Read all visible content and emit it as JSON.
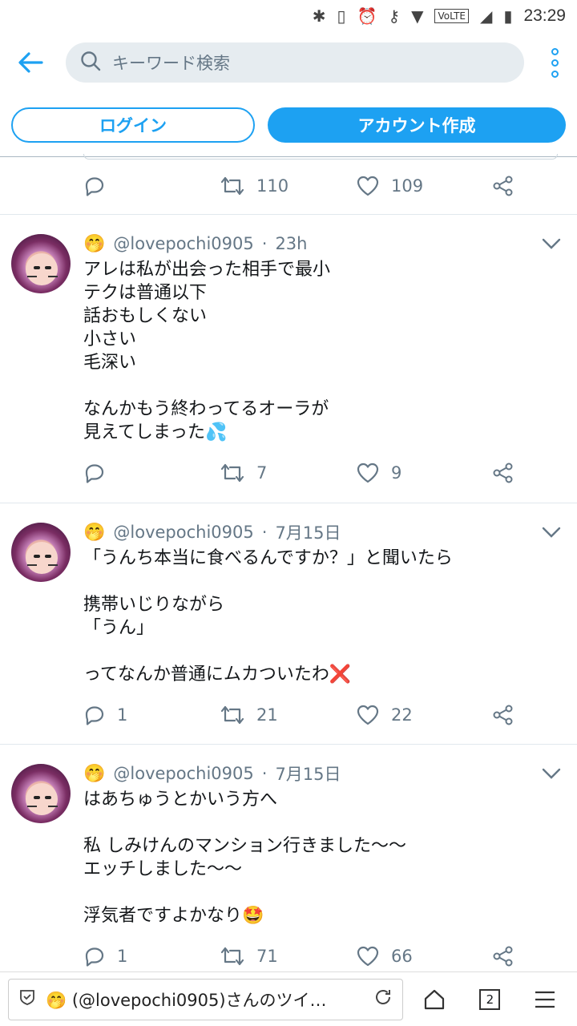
{
  "status_bar": {
    "time": "23:29",
    "volte": "VoLTE"
  },
  "search": {
    "placeholder": "キーワード検索"
  },
  "auth": {
    "login_label": "ログイン",
    "signup_label": "アカウント作成"
  },
  "partial_tweet": {
    "retweets": "110",
    "likes": "109"
  },
  "tweets": [
    {
      "handle": "@lovepochi0905",
      "time": "23h",
      "text": "アレは私が出会った相手で最小\nテクは普通以下\n話おもしくない\n小さい\n毛深い\n\nなんかもう終わってるオーラが\n見えてしまった💦",
      "replies": "",
      "retweets": "7",
      "likes": "9"
    },
    {
      "handle": "@lovepochi0905",
      "time": "7月15日",
      "text": "「うんち本当に食べるんですか？」と聞いたら\n\n携帯いじりながら\n「うん」\n\nってなんか普通にムカついたわ❌",
      "replies": "1",
      "retweets": "21",
      "likes": "22"
    },
    {
      "handle": "@lovepochi0905",
      "time": "7月15日",
      "text": "はあちゅうとかいう方へ\n\n私 しみけんのマンション行きました〜〜\nエッチしました〜〜\n\n浮気者ですよかなり🤩",
      "replies": "1",
      "retweets": "71",
      "likes": "66"
    }
  ],
  "handle_emoji": "🤭",
  "browser": {
    "tab_title": "🤭 (@lovepochi0905)さんのツイ…",
    "tab_count": "2"
  },
  "colors": {
    "accent": "#1da1f2",
    "muted": "#657786",
    "search_bg": "#e6ecf0"
  }
}
